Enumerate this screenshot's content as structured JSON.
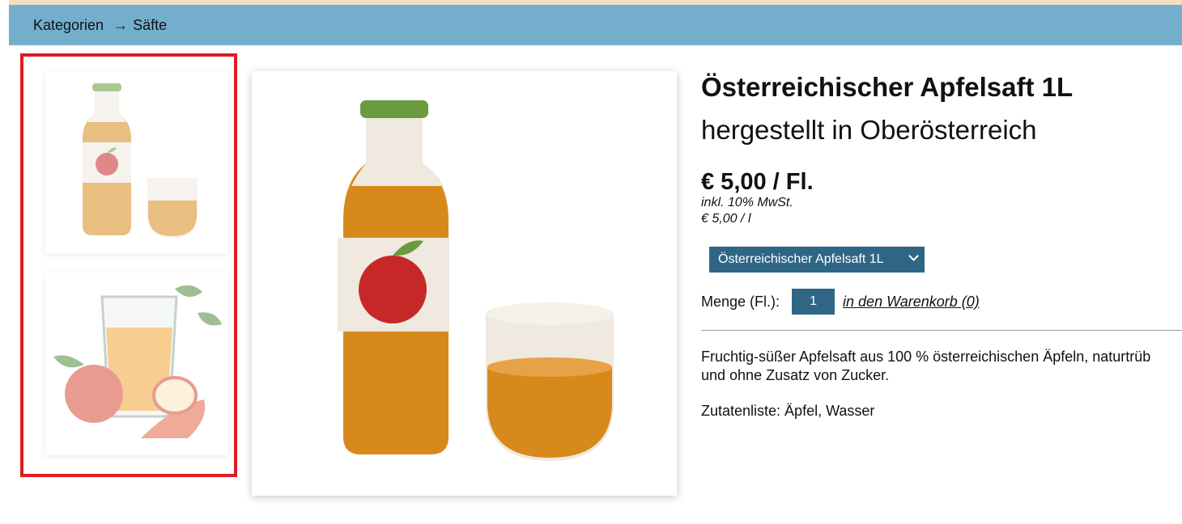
{
  "breadcrumb": {
    "first": "Kategorien",
    "separator": "→",
    "current": "Säfte"
  },
  "product": {
    "title": "Österreichischer Apfelsaft 1L",
    "subtitle": "hergestellt in Oberösterreich",
    "price": "€ 5,00 / Fl.",
    "tax_note": "inkl. 10% MwSt.",
    "unit_price": "€ 5,00 / l",
    "variant_selected": "Österreichischer Apfelsaft 1L",
    "quantity_label": "Menge (Fl.):",
    "quantity_value": "1",
    "cart_link": "in den Warenkorb (0)",
    "description": "Fruchtig-süßer Apfelsaft aus 100 % österreichischen Äpfeln, naturtrüb und ohne Zusatz von Zucker.",
    "ingredients": "Zutatenliste: Äpfel, Wasser"
  },
  "colors": {
    "breadcrumb_bg": "#74aecd",
    "accent_dark": "#2f6686",
    "highlight_border": "#e11b22",
    "juice": "#d8891c",
    "cap": "#6a9b3e"
  },
  "icons": {
    "variant_dropdown": "chevron-down-icon"
  }
}
